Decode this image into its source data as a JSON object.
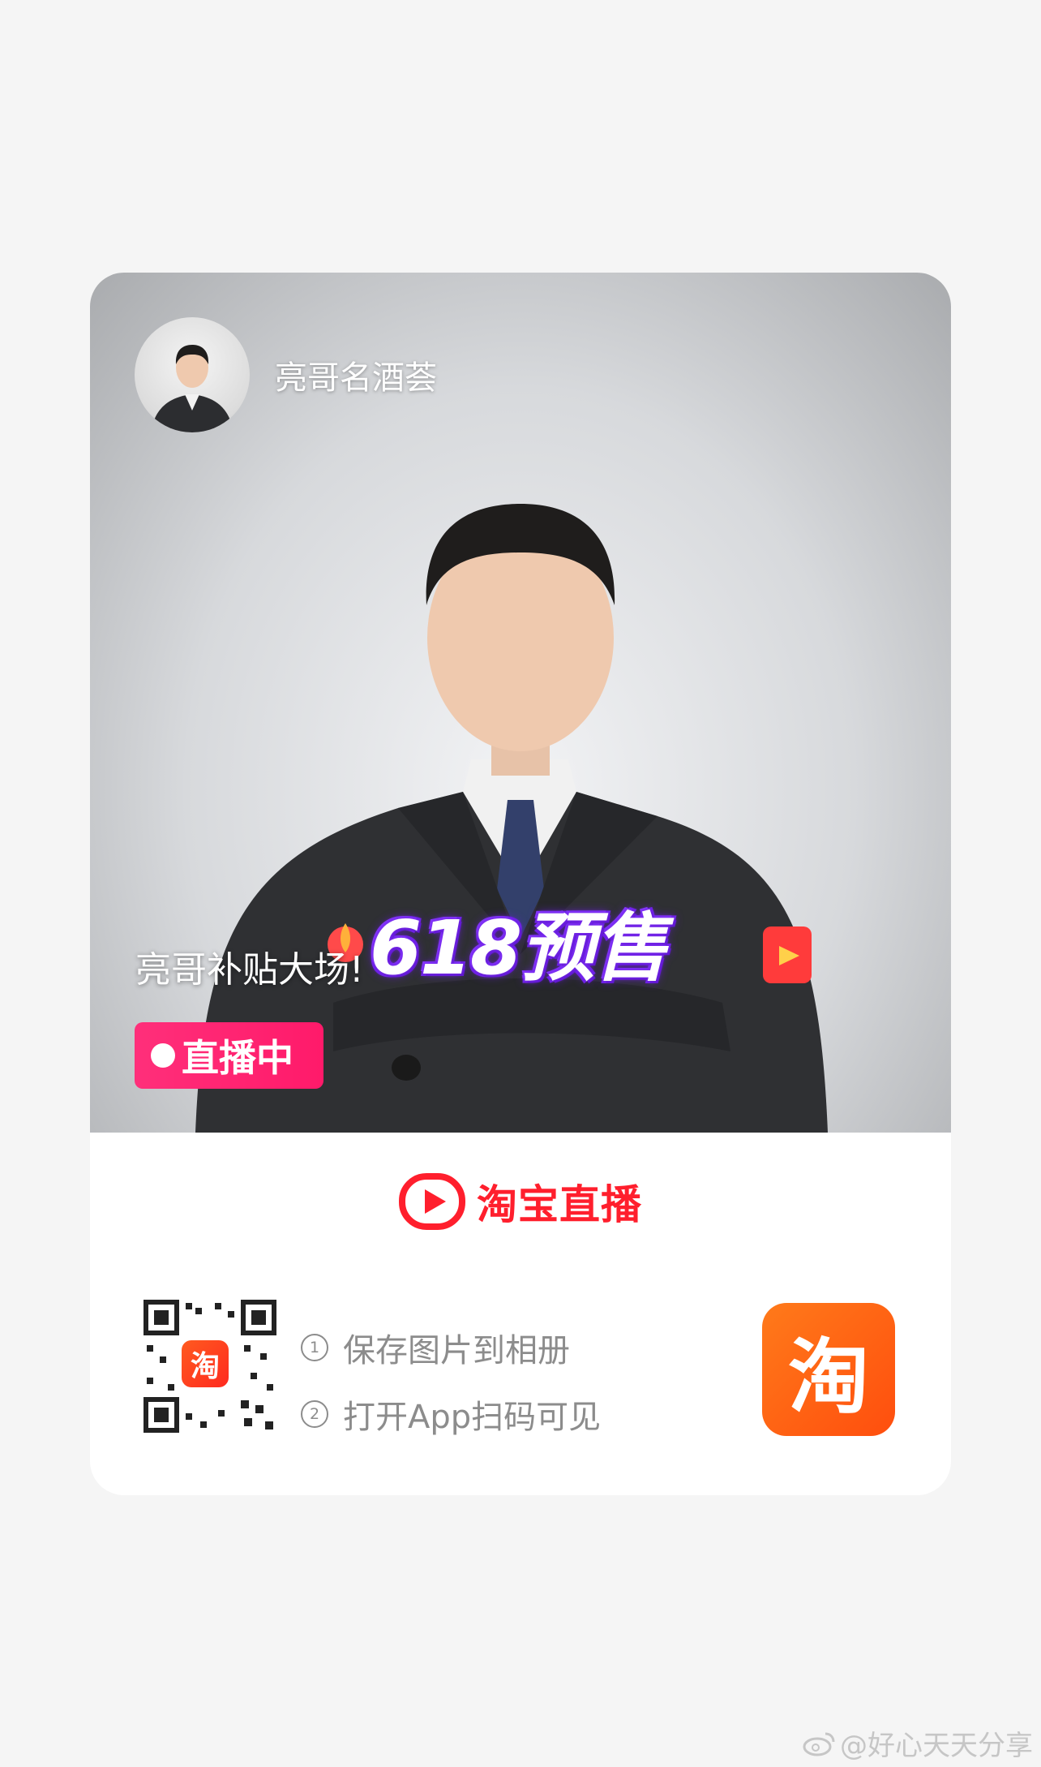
{
  "streamer": {
    "name": "亮哥名酒荟"
  },
  "live": {
    "title": "亮哥补贴大场!",
    "badge_label": "直播中",
    "promo_text": "618预售"
  },
  "brand": {
    "name": "淘宝直播",
    "color": "#ff1f2d"
  },
  "qr": {
    "center_label": "淘",
    "icon": "qr-code"
  },
  "steps": [
    {
      "num": "①",
      "text": "保存图片到相册"
    },
    {
      "num": "②",
      "text": "打开App扫码可见"
    }
  ],
  "app_icon": {
    "label": "淘",
    "color": "#ff5a12"
  },
  "watermark": {
    "text": "@好心天天分享",
    "icon": "weibo-icon"
  }
}
